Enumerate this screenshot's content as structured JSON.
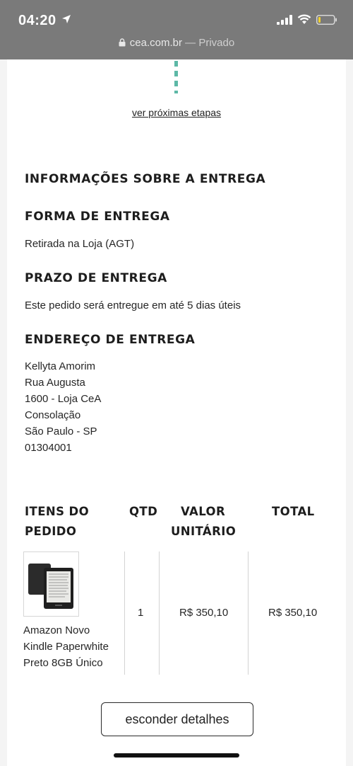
{
  "status_bar": {
    "time": "04:20",
    "url": "cea.com.br",
    "url_suffix": " — Privado",
    "icons": [
      "location-arrow-icon",
      "signal-bars-icon",
      "wifi-icon",
      "battery-icon"
    ]
  },
  "progress": {
    "next_steps_link": "ver próximas etapas"
  },
  "delivery": {
    "section_title": "INFORMAÇÕES SOBRE A ENTREGA",
    "method_title": "FORMA DE ENTREGA",
    "method_value": "Retirada na Loja (AGT)",
    "deadline_title": "PRAZO DE ENTREGA",
    "deadline_value": "Este pedido será entregue em até 5 dias úteis",
    "address_title": "ENDEREÇO DE ENTREGA",
    "address_lines": [
      "Kellyta Amorim",
      "Rua Augusta",
      "1600 - Loja CeA",
      "Consolação",
      "São Paulo - SP",
      "01304001"
    ]
  },
  "items_table": {
    "headers": {
      "items": [
        "ITENS DO",
        "PEDIDO"
      ],
      "qty": "QTD",
      "unit_price": [
        "VALOR",
        "UNITÁRIO"
      ],
      "total": "TOTAL"
    },
    "rows": [
      {
        "name_lines": [
          "Amazon Novo",
          "Kindle Paperwhite",
          "Preto 8GB Único"
        ],
        "qty": "1",
        "unit_price": "R$ 350,10",
        "total": "R$ 350,10",
        "image_icon": "kindle-product-image"
      }
    ]
  },
  "actions": {
    "hide_details": "esconder detalhes"
  },
  "colors": {
    "status_bar_bg": "#7a7a7a",
    "accent_dash": "#5db8a6",
    "page_bg": "#f4f4f4"
  }
}
